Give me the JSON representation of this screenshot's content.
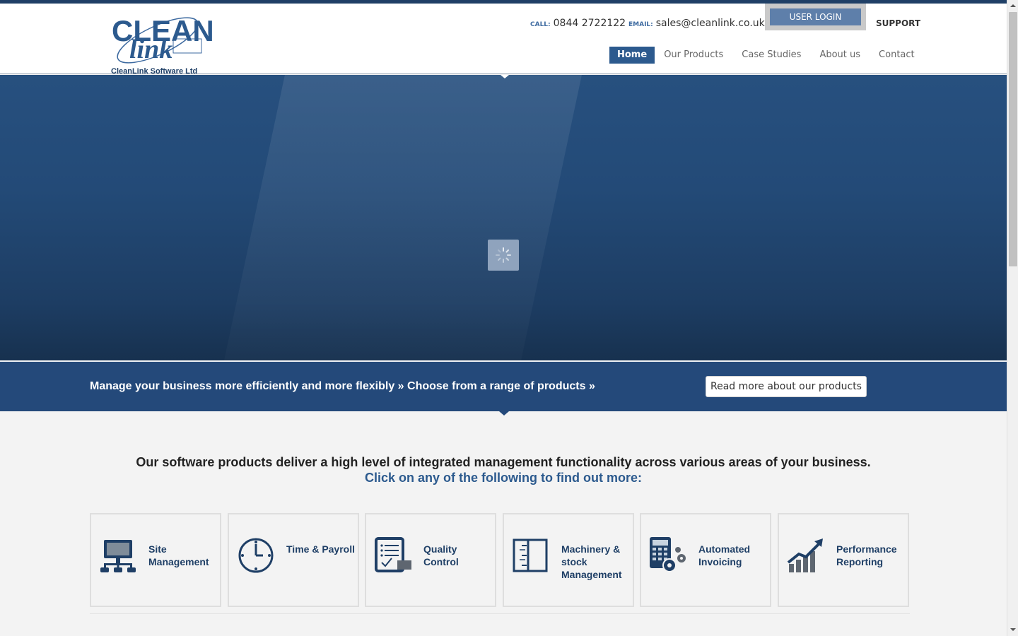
{
  "brand": {
    "logo_word1": "CLEAN",
    "logo_word2": "link",
    "company": "CleanLink Software Ltd"
  },
  "contact": {
    "call_label": "CALL:",
    "phone": "0844 2722122",
    "email_label": "EMAIL:",
    "email": "sales@cleanlink.co.uk"
  },
  "top_links": {
    "login": "USER LOGIN",
    "support": "SUPPORT"
  },
  "nav": {
    "items": [
      {
        "label": "Home",
        "active": true
      },
      {
        "label": "Our Products",
        "active": false
      },
      {
        "label": "Case Studies",
        "active": false
      },
      {
        "label": "About us",
        "active": false
      },
      {
        "label": "Contact",
        "active": false
      }
    ]
  },
  "banner": {
    "text": "Manage your business more efficiently and more flexibly » Choose from a range of products »",
    "button": "Read more about our products"
  },
  "intro": {
    "line1": "Our software products deliver a high level of integrated management functionality across various areas of your business.",
    "line2": "Click on any of the following to find out more:"
  },
  "products": [
    {
      "label": "Site Management",
      "icon": "network-computer-icon"
    },
    {
      "label": "Time & Payroll",
      "icon": "clock-icon"
    },
    {
      "label": "Quality Control",
      "icon": "checklist-icon"
    },
    {
      "label": "Machinery & stock Management",
      "icon": "binder-icon"
    },
    {
      "label": "Automated Invoicing",
      "icon": "calculator-gears-icon"
    },
    {
      "label": "Performance Reporting",
      "icon": "growth-chart-icon"
    }
  ],
  "colors": {
    "brand_blue": "#2c5a8e",
    "dark_blue": "#1f3f66",
    "banner_blue": "#24497a"
  }
}
